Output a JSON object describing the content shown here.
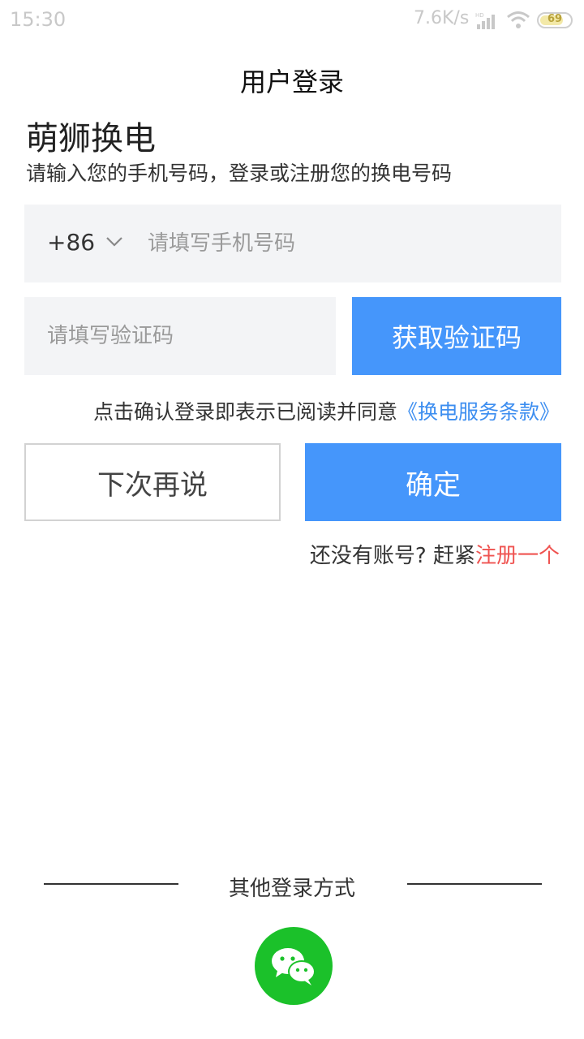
{
  "status_bar": {
    "time": "15:30",
    "net_speed": "7.6K/s",
    "battery": "69"
  },
  "header": {
    "title": "用户登录"
  },
  "brand": {
    "name": "萌狮换电",
    "subtitle": "请输入您的手机号码，登录或注册您的换电号码"
  },
  "phone": {
    "country_code": "+86",
    "placeholder": "请填写手机号码",
    "value": ""
  },
  "verify": {
    "placeholder": "请填写验证码",
    "value": "",
    "button_label": "获取验证码"
  },
  "terms": {
    "text": "点击确认登录即表示已阅读并同意",
    "link": "《换电服务条款》"
  },
  "actions": {
    "later_label": "下次再说",
    "confirm_label": "确定"
  },
  "register": {
    "prompt": "还没有账号? 赶紧",
    "link": "注册一个"
  },
  "other_login": {
    "label": "其他登录方式",
    "icon": "wechat-icon"
  },
  "colors": {
    "primary": "#4596fb",
    "link": "#3d8ef0",
    "register": "#ef5350",
    "wechat": "#1bc12a",
    "input_bg": "#f3f4f6"
  }
}
